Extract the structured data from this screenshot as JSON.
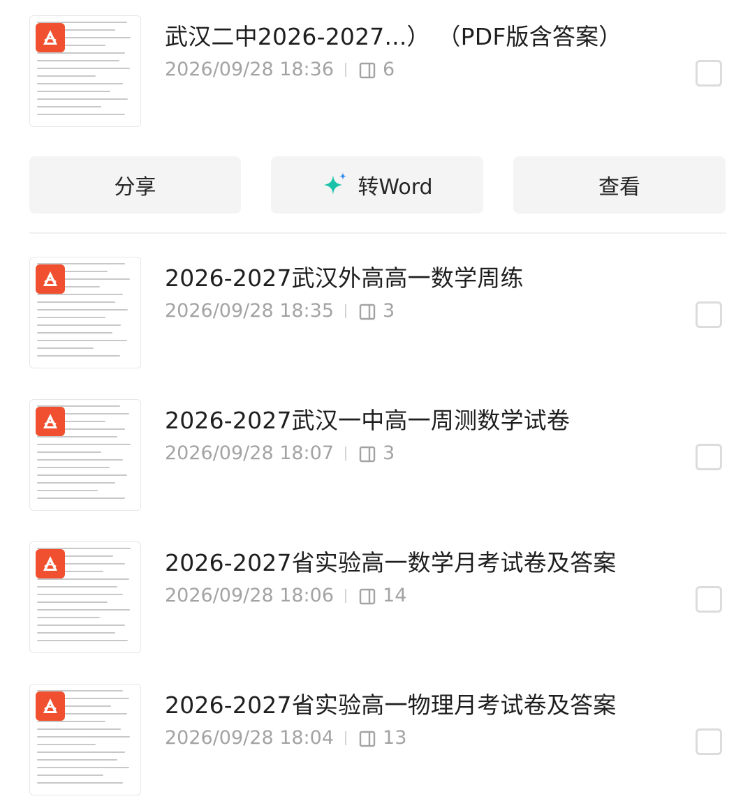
{
  "files": [
    {
      "title": "武汉二中2026-2027...） （PDF版含答案）",
      "date": "2026/09/28 18:36",
      "pages": "6",
      "icon": "pdf-icon"
    },
    {
      "title": "2026-2027武汉外高高一数学周练",
      "date": "2026/09/28 18:35",
      "pages": "3",
      "icon": "pdf-icon"
    },
    {
      "title": "2026-2027武汉一中高一周测数学试卷",
      "date": "2026/09/28 18:07",
      "pages": "3",
      "icon": "pdf-icon"
    },
    {
      "title": "2026-2027省实验高一数学月考试卷及答案",
      "date": "2026/09/28 18:06",
      "pages": "14",
      "icon": "pdf-icon"
    },
    {
      "title": "2026-2027省实验高一物理月考试卷及答案",
      "date": "2026/09/28 18:04",
      "pages": "13",
      "icon": "pdf-icon"
    }
  ],
  "actions": {
    "share_label": "分享",
    "convert_label": "转Word",
    "view_label": "查看"
  },
  "colors": {
    "pdf_badge": "#f0502f",
    "sparkle": "#19c2a8",
    "meta_text": "#a3a3a3"
  }
}
